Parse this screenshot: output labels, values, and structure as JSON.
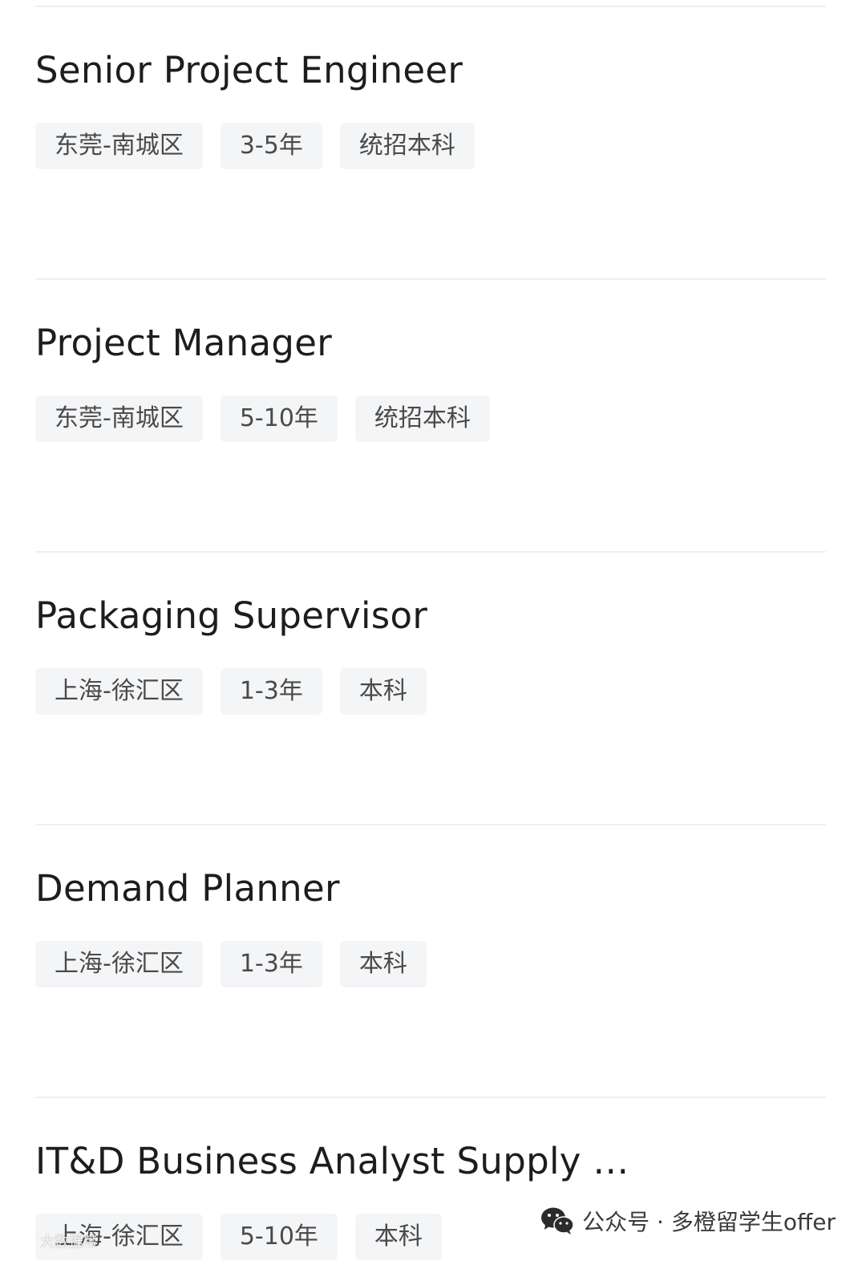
{
  "jobs": [
    {
      "title": "Senior Project Engineer",
      "tags": [
        "东莞-南城区",
        "3-5年",
        "统招本科"
      ]
    },
    {
      "title": "Project Manager",
      "tags": [
        "东莞-南城区",
        "5-10年",
        "统招本科"
      ]
    },
    {
      "title": "Packaging Supervisor",
      "tags": [
        "上海-徐汇区",
        "1-3年",
        "本科"
      ]
    },
    {
      "title": "Demand Planner",
      "tags": [
        "上海-徐汇区",
        "1-3年",
        "本科"
      ]
    },
    {
      "title": "IT&D Business Analyst Supply …",
      "tags": [
        "上海-徐汇区",
        "5-10年",
        "本科"
      ]
    }
  ],
  "watermark": {
    "icon": "wechat-icon",
    "text": "公众号 · 多橙留学生offer"
  },
  "corner_mark": {
    "text": "大数据帝"
  },
  "colors": {
    "tag_bg": "#f4f5f7",
    "divider": "#efefef",
    "title": "#1d1d1d",
    "tag_text": "#4a4a4a"
  }
}
